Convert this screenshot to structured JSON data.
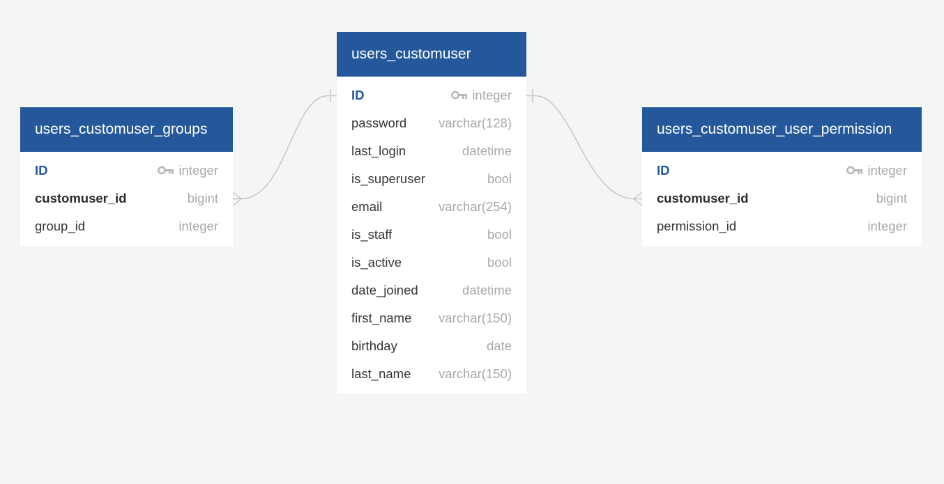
{
  "tables": {
    "groups": {
      "name": "users_customuser_groups",
      "fields": [
        {
          "name": "ID",
          "type": "integer",
          "role": "pk"
        },
        {
          "name": "customuser_id",
          "type": "bigint",
          "role": "fk"
        },
        {
          "name": "group_id",
          "type": "integer",
          "role": "normal"
        }
      ]
    },
    "customuser": {
      "name": "users_customuser",
      "fields": [
        {
          "name": "ID",
          "type": "integer",
          "role": "pk"
        },
        {
          "name": "password",
          "type": "varchar(128)",
          "role": "normal"
        },
        {
          "name": "last_login",
          "type": "datetime",
          "role": "normal"
        },
        {
          "name": "is_superuser",
          "type": "bool",
          "role": "normal"
        },
        {
          "name": "email",
          "type": "varchar(254)",
          "role": "normal"
        },
        {
          "name": "is_staff",
          "type": "bool",
          "role": "normal"
        },
        {
          "name": "is_active",
          "type": "bool",
          "role": "normal"
        },
        {
          "name": "date_joined",
          "type": "datetime",
          "role": "normal"
        },
        {
          "name": "first_name",
          "type": "varchar(150)",
          "role": "normal"
        },
        {
          "name": "birthday",
          "type": "date",
          "role": "normal"
        },
        {
          "name": "last_name",
          "type": "varchar(150)",
          "role": "normal"
        }
      ]
    },
    "permissions": {
      "name": "users_customuser_user_permission",
      "fields": [
        {
          "name": "ID",
          "type": "integer",
          "role": "pk"
        },
        {
          "name": "customuser_id",
          "type": "bigint",
          "role": "fk"
        },
        {
          "name": "permission_id",
          "type": "integer",
          "role": "normal"
        }
      ]
    }
  },
  "relationships": [
    {
      "from": "users_customuser.ID",
      "to": "users_customuser_groups.customuser_id",
      "cardinality": "one-to-many"
    },
    {
      "from": "users_customuser.ID",
      "to": "users_customuser_user_permission.customuser_id",
      "cardinality": "one-to-many"
    }
  ],
  "colors": {
    "header": "#25589b",
    "background": "#f4f5f5",
    "connector": "#c4c4c4",
    "type_text": "#a9a9a9",
    "key_icon": "#b8b8b8"
  },
  "icons": {
    "primary_key": "key-icon"
  }
}
